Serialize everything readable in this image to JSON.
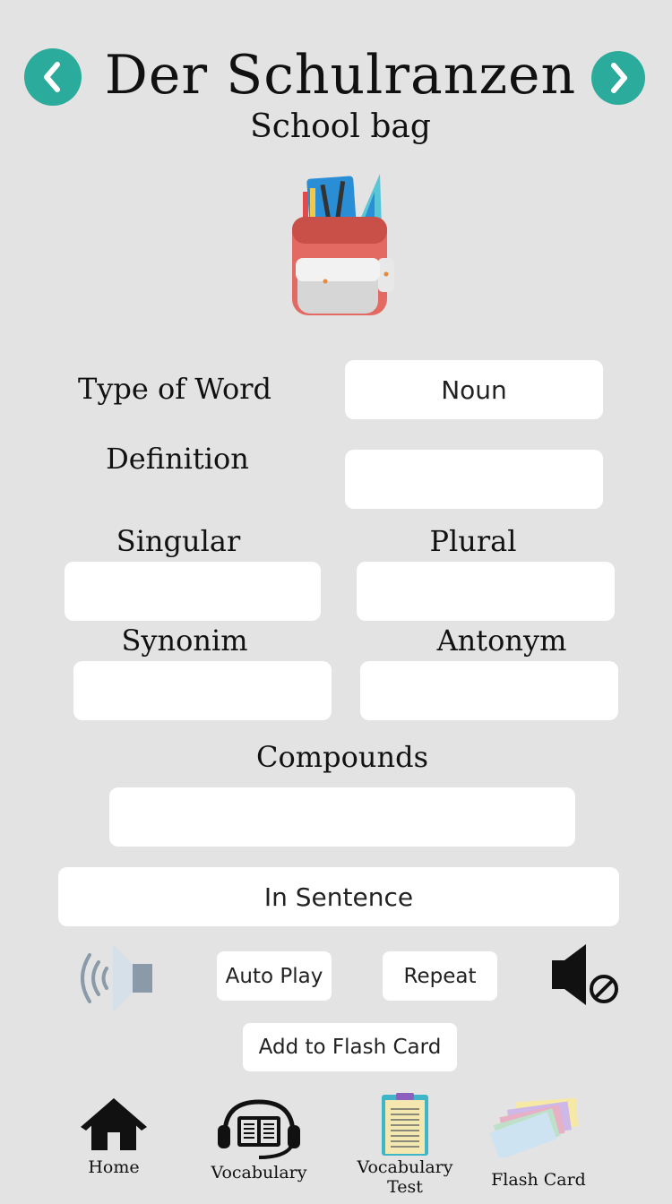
{
  "header": {
    "title": "Der Schulranzen",
    "subtitle": "School bag",
    "prev_icon": "chevron-left-icon",
    "next_icon": "chevron-right-icon"
  },
  "image": {
    "icon": "school-backpack-illustration"
  },
  "fields": {
    "type_label": "Type of Word",
    "type_value": "Noun",
    "definition_label": "Definition",
    "definition_value": "",
    "singular_label": "Singular",
    "singular_value": "",
    "plural_label": "Plural",
    "plural_value": "",
    "synonim_label": "Synonim",
    "synonim_value": "",
    "antonym_label": "Antonym",
    "antonym_value": "",
    "compounds_label": "Compounds",
    "compounds_value": ""
  },
  "sentence_button": "In Sentence",
  "controls": {
    "speaker_icon": "speaker-icon",
    "auto_play": "Auto Play",
    "repeat": "Repeat",
    "mute_icon": "mute-icon",
    "add_flash_card": "Add to Flash Card"
  },
  "bottom_nav": {
    "items": [
      {
        "label": "Home",
        "icon": "home-icon"
      },
      {
        "label": "Vocabulary",
        "icon": "book-headphones-icon"
      },
      {
        "label": "Vocabulary Test",
        "icon": "clipboard-icon"
      },
      {
        "label": "Flash Card",
        "icon": "flash-cards-icon"
      }
    ]
  },
  "colors": {
    "accent": "#2aab9b",
    "background": "#e3e3e3",
    "field": "#ffffff"
  }
}
